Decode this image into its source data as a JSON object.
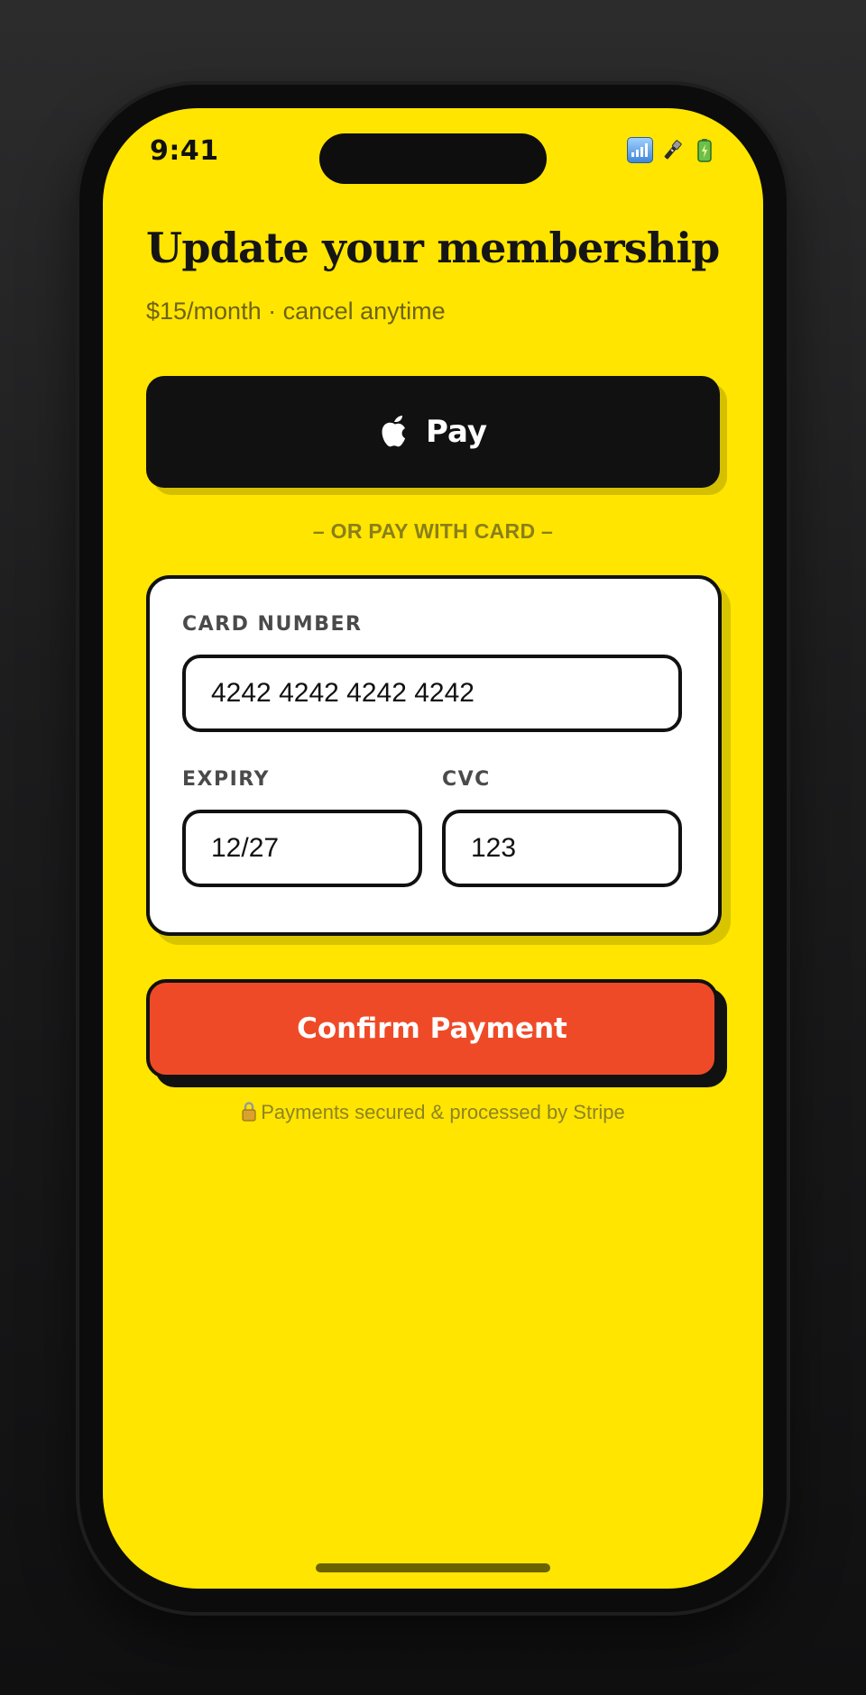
{
  "status_bar": {
    "time": "9:41",
    "icons": [
      "signal-icon",
      "flashlight-icon",
      "battery-icon"
    ]
  },
  "header": {
    "title": "Update your membership",
    "subtitle": "$15/month · cancel anytime"
  },
  "apple_pay": {
    "icon": "apple-logo-icon",
    "label": "Pay"
  },
  "divider": {
    "text": "– OR PAY WITH CARD –"
  },
  "card_form": {
    "card_number_label": "CARD NUMBER",
    "card_number_value": "4242 4242 4242 4242",
    "expiry_label": "EXPIRY",
    "expiry_value": "12/27",
    "cvc_label": "CVC",
    "cvc_value": "123"
  },
  "confirm": {
    "label": "Confirm Payment"
  },
  "footer": {
    "icon": "lock-icon",
    "secure_text": "Payments secured & processed by Stripe"
  },
  "colors": {
    "background": "#ffe500",
    "confirm_button": "#ef4a27",
    "apple_pay_button": "#111111",
    "card_surface": "#ffffff"
  }
}
